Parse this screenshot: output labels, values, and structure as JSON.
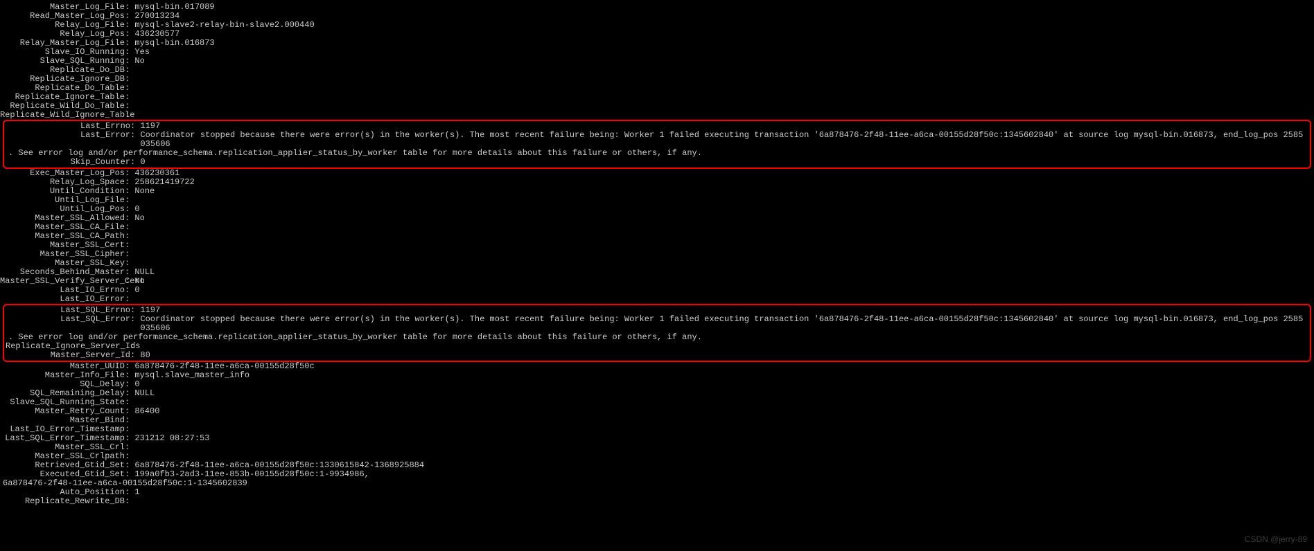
{
  "rows_block_a": [
    {
      "k": "Master_Log_File",
      "v": "mysql-bin.017089"
    },
    {
      "k": "Read_Master_Log_Pos",
      "v": "270013234"
    },
    {
      "k": "Relay_Log_File",
      "v": "mysql-slave2-relay-bin-slave2.000440"
    },
    {
      "k": "Relay_Log_Pos",
      "v": "436230577"
    },
    {
      "k": "Relay_Master_Log_File",
      "v": "mysql-bin.016873"
    },
    {
      "k": "Slave_IO_Running",
      "v": "Yes"
    },
    {
      "k": "Slave_SQL_Running",
      "v": "No"
    },
    {
      "k": "Replicate_Do_DB",
      "v": ""
    },
    {
      "k": "Replicate_Ignore_DB",
      "v": ""
    },
    {
      "k": "Replicate_Do_Table",
      "v": ""
    },
    {
      "k": "Replicate_Ignore_Table",
      "v": ""
    },
    {
      "k": "Replicate_Wild_Do_Table",
      "v": ""
    },
    {
      "k": "Replicate_Wild_Ignore_Table",
      "v": ""
    }
  ],
  "highlight1": {
    "errno_k": "Last_Errno",
    "errno_v": "1197",
    "error_k": "Last_Error",
    "error_v": "Coordinator stopped because there were error(s) in the worker(s). The most recent failure being: Worker 1 failed executing transaction '6a878476-2f48-11ee-a6ca-00155d28f50c:1345602840' at source log mysql-bin.016873, end_log_pos 2585035606",
    "error_wrap": ". See error log and/or performance_schema.replication_applier_status_by_worker table for more details about this failure or others, if any.",
    "skip_k": "Skip_Counter",
    "skip_v": "0"
  },
  "rows_block_b": [
    {
      "k": "Exec_Master_Log_Pos",
      "v": "436230361"
    },
    {
      "k": "Relay_Log_Space",
      "v": "258621419722"
    },
    {
      "k": "Until_Condition",
      "v": "None"
    },
    {
      "k": "Until_Log_File",
      "v": ""
    },
    {
      "k": "Until_Log_Pos",
      "v": "0"
    },
    {
      "k": "Master_SSL_Allowed",
      "v": "No"
    },
    {
      "k": "Master_SSL_CA_File",
      "v": ""
    },
    {
      "k": "Master_SSL_CA_Path",
      "v": ""
    },
    {
      "k": "Master_SSL_Cert",
      "v": ""
    },
    {
      "k": "Master_SSL_Cipher",
      "v": ""
    },
    {
      "k": "Master_SSL_Key",
      "v": ""
    },
    {
      "k": "Seconds_Behind_Master",
      "v": "NULL"
    },
    {
      "k": "Master_SSL_Verify_Server_Cert",
      "v": "No"
    },
    {
      "k": "Last_IO_Errno",
      "v": "0"
    },
    {
      "k": "Last_IO_Error",
      "v": ""
    }
  ],
  "highlight2": {
    "errno_k": "Last_SQL_Errno",
    "errno_v": "1197",
    "error_k": "Last_SQL_Error",
    "error_v": "Coordinator stopped because there were error(s) in the worker(s). The most recent failure being: Worker 1 failed executing transaction '6a878476-2f48-11ee-a6ca-00155d28f50c:1345602840' at source log mysql-bin.016873, end_log_pos 2585035606",
    "error_wrap": ". See error log and/or performance_schema.replication_applier_status_by_worker table for more details about this failure or others, if any.",
    "rep_k": "Replicate_Ignore_Server_Ids",
    "rep_v": "",
    "srv_k": "Master_Server_Id",
    "srv_v": "80"
  },
  "rows_block_c": [
    {
      "k": "Master_UUID",
      "v": "6a878476-2f48-11ee-a6ca-00155d28f50c"
    },
    {
      "k": "Master_Info_File",
      "v": "mysql.slave_master_info"
    },
    {
      "k": "SQL_Delay",
      "v": "0"
    },
    {
      "k": "SQL_Remaining_Delay",
      "v": "NULL"
    },
    {
      "k": "Slave_SQL_Running_State",
      "v": ""
    },
    {
      "k": "Master_Retry_Count",
      "v": "86400"
    },
    {
      "k": "Master_Bind",
      "v": ""
    },
    {
      "k": "Last_IO_Error_Timestamp",
      "v": ""
    },
    {
      "k": "Last_SQL_Error_Timestamp",
      "v": "231212 08:27:53"
    },
    {
      "k": "Master_SSL_Crl",
      "v": ""
    },
    {
      "k": "Master_SSL_Crlpath",
      "v": ""
    },
    {
      "k": "Retrieved_Gtid_Set",
      "v": "6a878476-2f48-11ee-a6ca-00155d28f50c:1330615842-1368925884"
    },
    {
      "k": "Executed_Gtid_Set",
      "v": "199a0fb3-2ad3-11ee-853b-00155d28f50c:1-9934986,"
    }
  ],
  "gtid_wrap": "6a878476-2f48-11ee-a6ca-00155d28f50c:1-1345602839",
  "rows_block_d": [
    {
      "k": "Auto_Position",
      "v": "1"
    },
    {
      "k": "Replicate_Rewrite_DB",
      "v": ""
    }
  ],
  "watermark": "CSDN @jerry-89"
}
